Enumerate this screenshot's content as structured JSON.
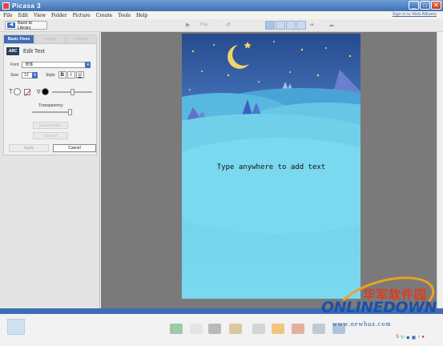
{
  "window": {
    "title": "Picasa 3",
    "buttons": {
      "minimize": "_",
      "maximize": "□",
      "close": "✕"
    }
  },
  "menu": {
    "items": [
      "File",
      "Edit",
      "View",
      "Folder",
      "Picture",
      "Create",
      "Tools",
      "Help"
    ],
    "sign_in": "Sign in to Web Albums"
  },
  "toolbar": {
    "back_label": "Back to Library",
    "play_label": "Play"
  },
  "panel": {
    "tabs": [
      "Basic Fixes",
      "Tuning",
      "Effects"
    ],
    "edit_title": "Edit Text",
    "font_label": "Font:",
    "font_value": "宋体",
    "size_label": "Size:",
    "size_value": "12",
    "style_label": "Style:",
    "style_buttons": [
      "B",
      "I",
      "U"
    ],
    "transparency_label": "Transparency",
    "clear_button": "Clear Position",
    "clear_all_button": "Clear All",
    "apply_button": "Apply",
    "cancel_button": "Cancel"
  },
  "canvas": {
    "overlay_text": "Type anywhere to add text"
  },
  "watermark": {
    "chinese": "华军软件园",
    "brand": "ONLINEDOWN",
    "url": "www.newhua.com"
  },
  "colors": {
    "accent": "#3f6db5",
    "sky_top": "#274a8e",
    "hill": "#7ad9ef",
    "watermark_blue": "#1e4fa8",
    "watermark_red": "#e03a1e"
  }
}
